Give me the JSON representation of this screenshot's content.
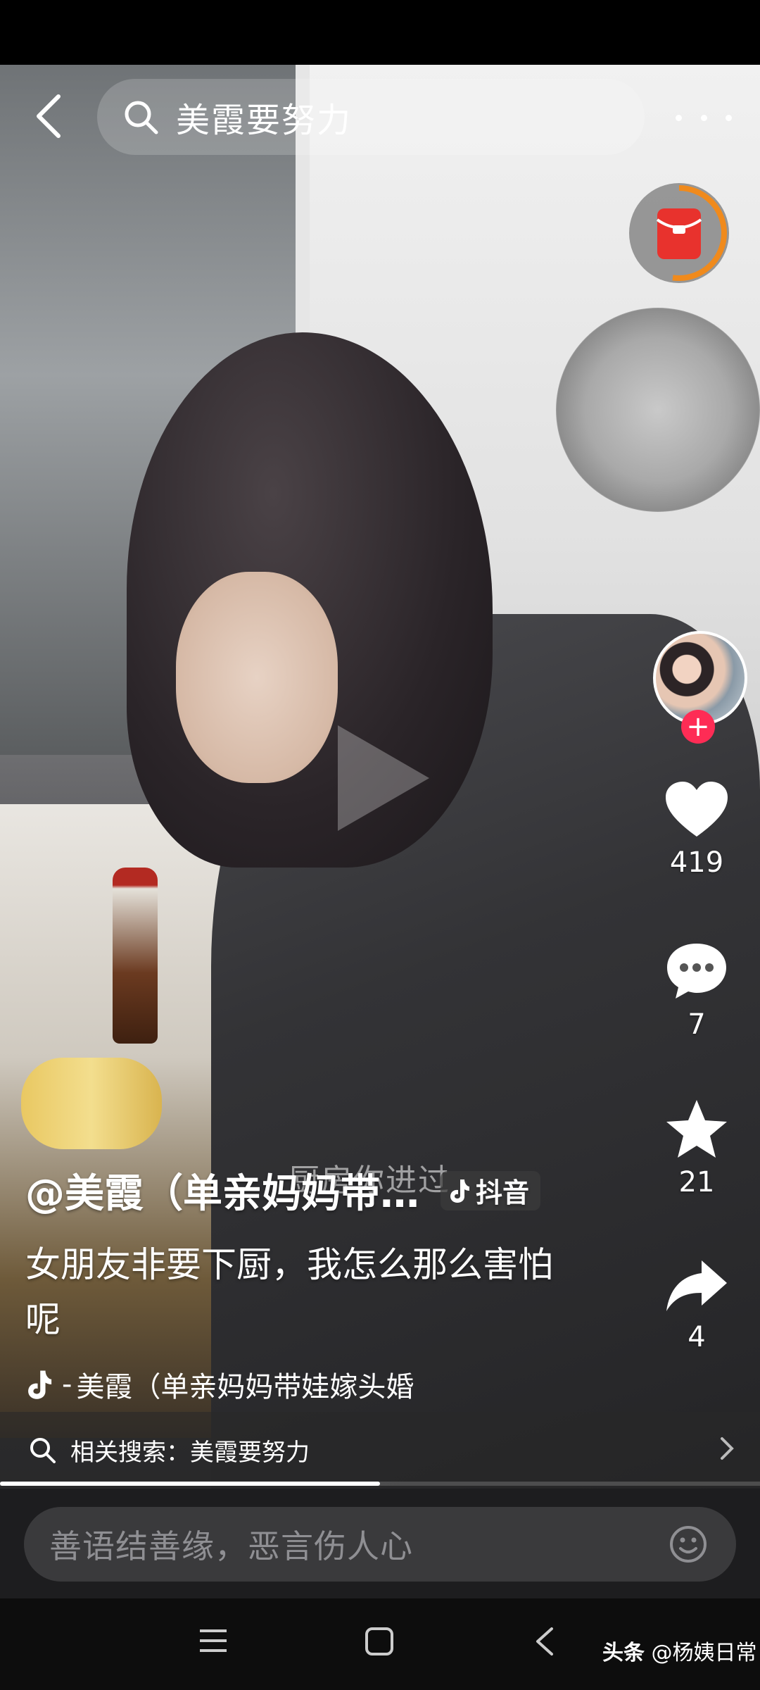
{
  "search": {
    "query": "美霞要努力"
  },
  "video": {
    "overlay_subtitle": "厨房你进过",
    "progress_percent": 50
  },
  "actions": {
    "likes": "419",
    "comments": "7",
    "favorites": "21",
    "shares": "4"
  },
  "caption": {
    "author": "@美霞（单亲妈妈带…",
    "platform_badge": "抖音",
    "description": "女朋友非要下厨，我怎么那么害怕呢",
    "music": "美霞（单亲妈妈带娃嫁头婚"
  },
  "related": {
    "label": "相关搜索：美霞要努力"
  },
  "comment": {
    "placeholder": "善语结善缘，恶言伤人心"
  },
  "watermark": {
    "brand": "头条",
    "handle": "@杨姨日常"
  },
  "colors": {
    "accent": "#fe2c55",
    "redpacket": "#e8322d",
    "ring": "#f08a1c"
  },
  "icons": [
    "back-icon",
    "search-icon",
    "more-icon",
    "red-packet-icon",
    "play-icon",
    "heart-icon",
    "comment-icon",
    "star-icon",
    "share-icon",
    "douyin-icon",
    "magnifier-icon",
    "chevron-right-icon",
    "emoji-icon",
    "menu-icon",
    "home-icon",
    "nav-back-icon"
  ]
}
